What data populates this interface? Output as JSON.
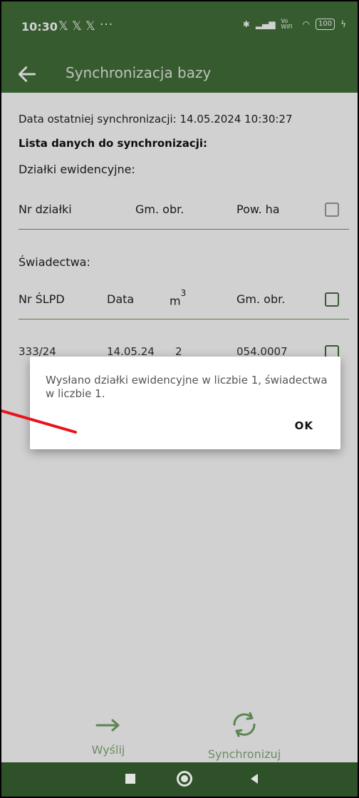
{
  "status_bar": {
    "time": "10:30",
    "x_icons": [
      "𝕏",
      "𝕏",
      "𝕏"
    ],
    "dots": "···",
    "signal_text": "Vo WiFi",
    "battery": "100"
  },
  "app_bar": {
    "title": "Synchronizacja bazy"
  },
  "content": {
    "last_sync": "Data ostatniej synchronizacji: 14.05.2024 10:30:27",
    "list_title": "Lista danych do synchronizacji:",
    "parcels_label": "Działki ewidencyjne:",
    "parcels_headers": {
      "nr": "Nr działki",
      "gm": "Gm. obr.",
      "pow": "Pow. ha"
    },
    "certificates_label": "Świadectwa:",
    "cert_headers": {
      "nr": "Nr ŚLPD",
      "data": "Data",
      "m": "m",
      "m_sup": "3",
      "gm": "Gm. obr."
    },
    "cert_rows": [
      {
        "nr": "333/24",
        "data": "14.05.24",
        "m": "2",
        "gm": "054.0007"
      }
    ]
  },
  "dialog": {
    "message": "Wysłano działki ewidencyjne w liczbie 1, świadectwa w liczbie 1.",
    "ok_label": "OK"
  },
  "bottom_actions": {
    "send_label": "Wyślij",
    "sync_label": "Synchronizuj"
  },
  "colors": {
    "primary": "#436f3a",
    "nav_bar": "#2f5129",
    "annotation_arrow": "#e8141c"
  }
}
